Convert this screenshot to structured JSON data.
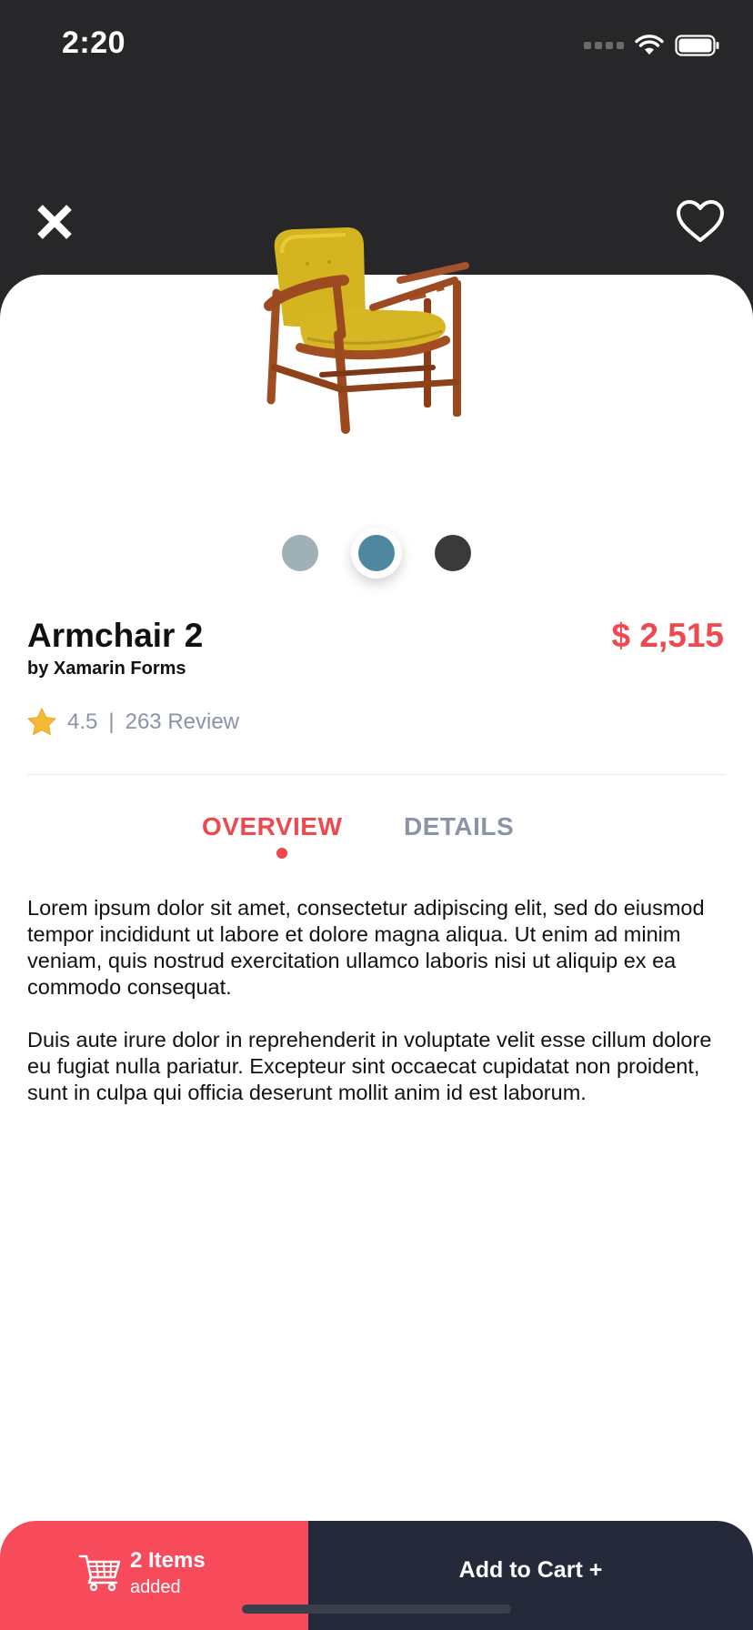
{
  "status_bar": {
    "time": "2:20"
  },
  "header": {
    "close_icon": "close-icon",
    "favorite_icon": "heart-icon"
  },
  "product": {
    "name": "Armchair 2",
    "brand": "by Xamarin Forms",
    "price": "$ 2,515",
    "rating": "4.5",
    "separator": "|",
    "reviews": "263 Review",
    "colors": [
      "#9fb0b6",
      "#4f86a0",
      "#3a3a3a"
    ],
    "selected_color_index": 1
  },
  "tabs": {
    "overview": "OVERVIEW",
    "details": "DETAILS",
    "active": "OVERVIEW"
  },
  "description": {
    "paragraph_1": "Lorem ipsum dolor sit amet, consectetur adipiscing elit, sed do eiusmod tempor incididunt ut labore et dolore magna aliqua. Ut enim ad minim veniam, quis nostrud exercitation ullamco laboris nisi ut aliquip ex ea commodo consequat.",
    "paragraph_2": "Duis aute irure dolor in reprehenderit in voluptate velit esse cillum dolore eu fugiat nulla pariatur. Excepteur sint occaecat cupidatat non proident, sunt in culpa qui officia deserunt mollit anim id est laborum."
  },
  "cart": {
    "count_label": "2 Items",
    "sub_label": "added",
    "add_button": "Add to Cart +"
  },
  "colors": {
    "accent": "#f0484f",
    "cart_red": "#f74b5b",
    "dark": "#252a3a",
    "header_bg": "#27272a",
    "muted": "#8a93a8"
  }
}
